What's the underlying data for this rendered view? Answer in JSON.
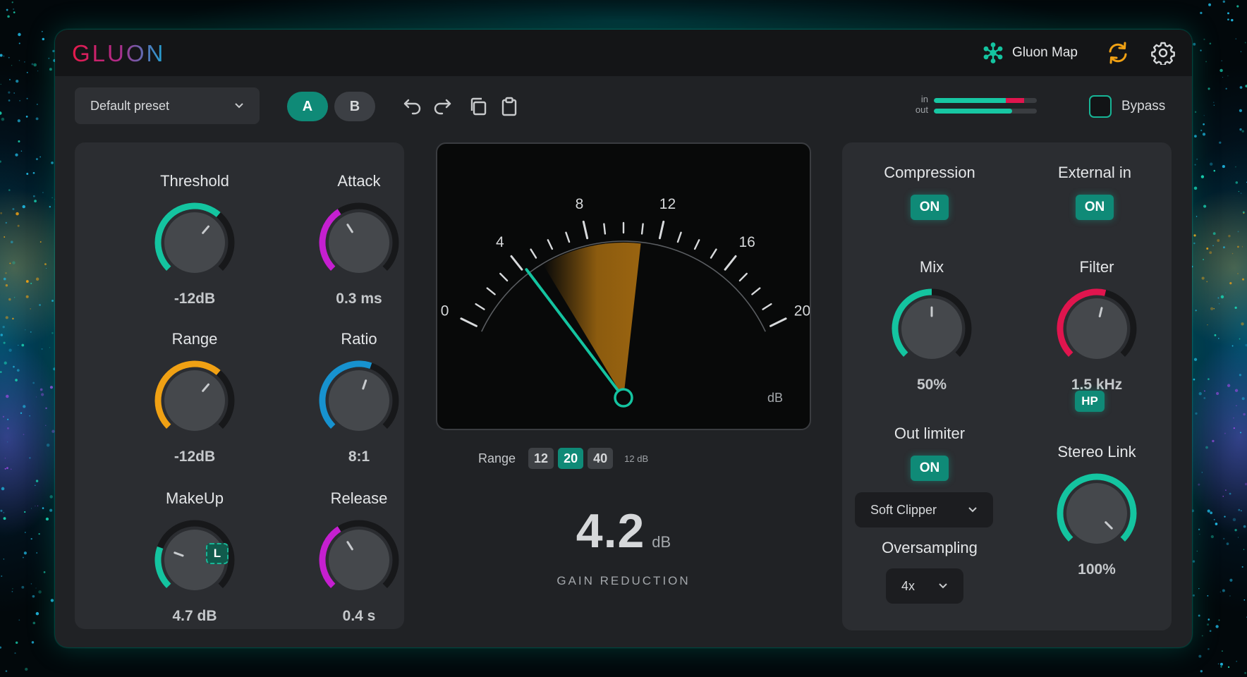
{
  "app": {
    "logo_text": "GLUON",
    "map_label": "Gluon Map",
    "map_icon": "snowflake-icon",
    "sync_icon": "sync-icon",
    "settings_icon": "gear-icon"
  },
  "toolbar": {
    "preset": "Default preset",
    "a_label": "A",
    "b_label": "B",
    "meter_in_label": "in",
    "meter_out_label": "out",
    "meter_in_level": 0.88,
    "meter_out_level": 0.76,
    "bypass_label": "Bypass",
    "bypass_on": false
  },
  "left_knobs": [
    {
      "label": "Threshold",
      "value": "-12dB",
      "color": "#14c4a0",
      "level": 0.65
    },
    {
      "label": "Attack",
      "value": "0.3 ms",
      "color": "#c51fd0",
      "level": 0.38
    },
    {
      "label": "Range",
      "value": "-12dB",
      "color": "#f0a114",
      "level": 0.65
    },
    {
      "label": "Ratio",
      "value": "8:1",
      "color": "#1792cf",
      "level": 0.57
    },
    {
      "label": "MakeUp",
      "value": "4.7 dB",
      "color": "#14c4a0",
      "level": 0.24
    },
    {
      "label": "Release",
      "value": "0.4 s",
      "color": "#c51fd0",
      "level": 0.38
    }
  ],
  "makeup_link": "L",
  "meter": {
    "scale": [
      "0",
      "4",
      "8",
      "12",
      "16",
      "20"
    ],
    "unit": "dB",
    "needle_value": 4.2,
    "range_label": "Range",
    "range_options": [
      "12",
      "20",
      "40"
    ],
    "range_selected": "20",
    "range_unit": "12 dB",
    "gain_reduction_value": "4.2",
    "gain_reduction_unit": "dB",
    "gain_reduction_label": "GAIN REDUCTION"
  },
  "right": {
    "compression_label": "Compression",
    "compression_state": "ON",
    "external_label": "External in",
    "external_state": "ON",
    "mix": {
      "label": "Mix",
      "value": "50%",
      "color": "#14c4a0",
      "level": 0.5
    },
    "filter": {
      "label": "Filter",
      "value": "1.5 kHz",
      "color": "#e0154e",
      "level": 0.55
    },
    "filter_mode": "HP",
    "out_limiter_label": "Out limiter",
    "out_limiter_state": "ON",
    "clipper_select": "Soft Clipper",
    "oversampling_label": "Oversampling",
    "oversampling_select": "4x",
    "stereo": {
      "label": "Stereo Link",
      "value": "100%",
      "color": "#14c4a0",
      "level": 1.0
    }
  }
}
